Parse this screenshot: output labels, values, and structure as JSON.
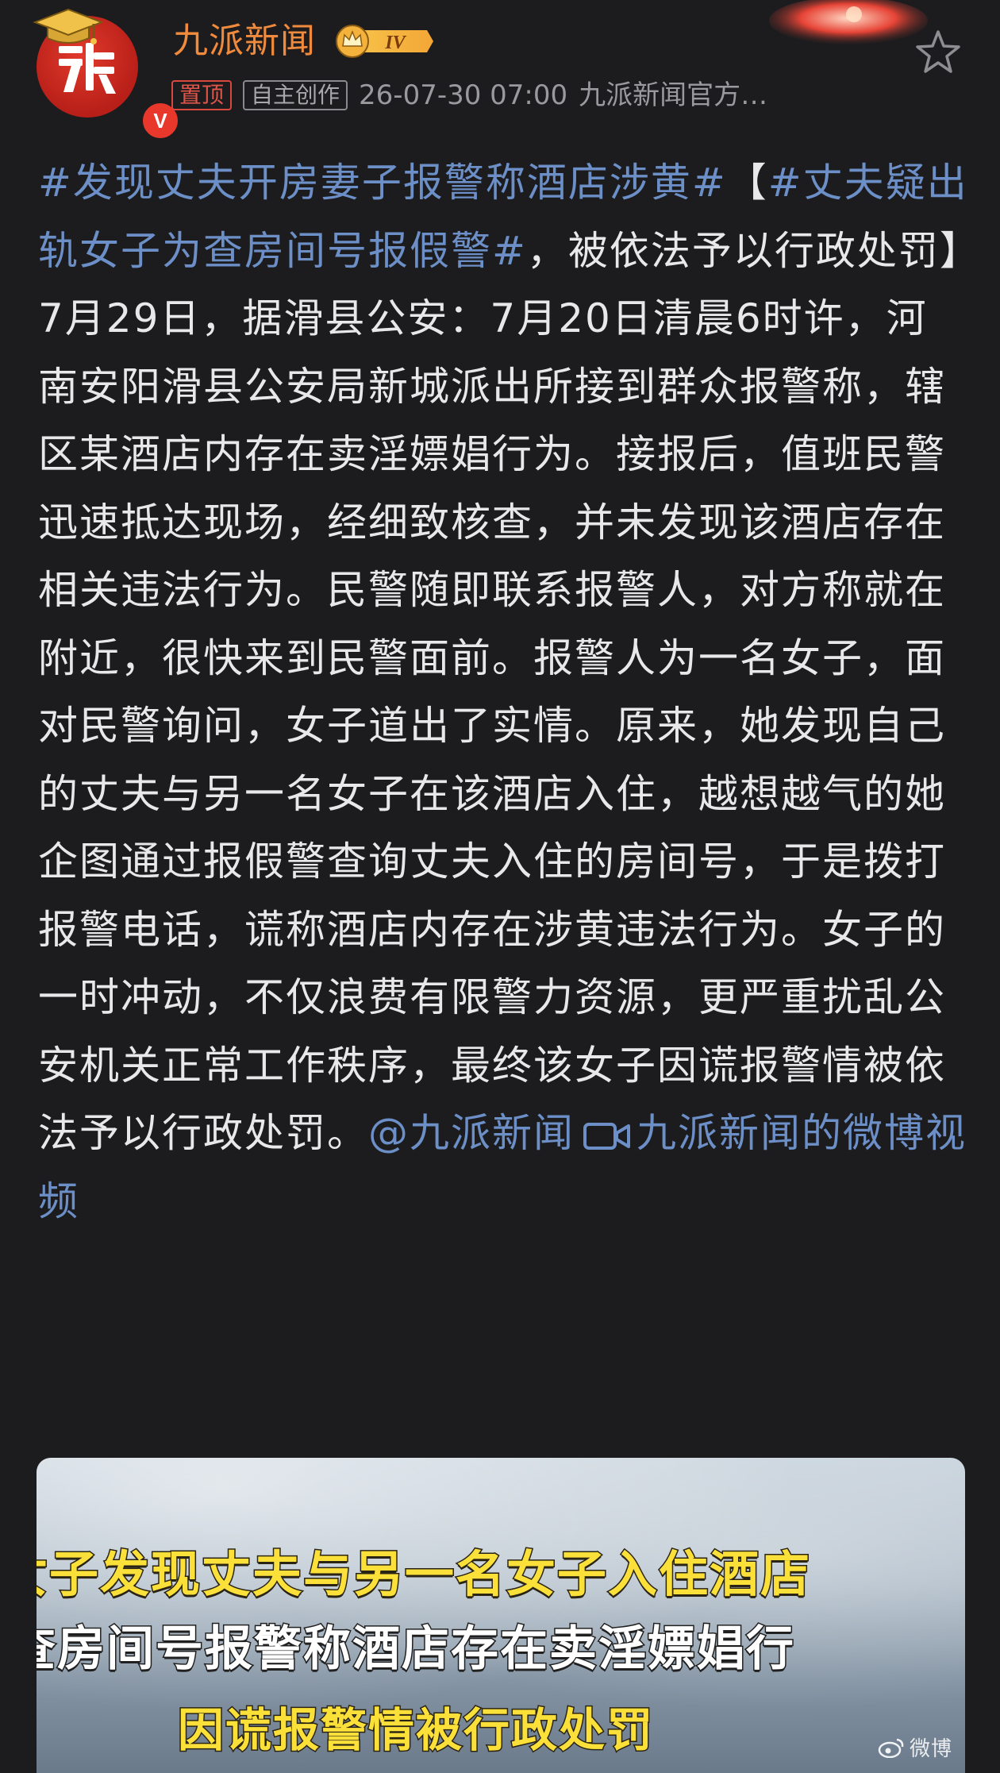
{
  "author": {
    "name": "九派新闻",
    "level_badge": "IV",
    "verified_mark": "V",
    "avatar_icon": "jiupai-logo-icon"
  },
  "meta": {
    "pinned_label": "置顶",
    "original_label": "自主创作",
    "timestamp": "26-07-30 07:00",
    "source": "九派新闻官方…"
  },
  "post": {
    "hashtag1": "#发现丈夫开房妻子报警称酒店涉黄#",
    "bracket_open": "【",
    "hashtag2": "#丈夫疑出轨女子为查房间号报假警#",
    "after_hashtag2": "，被依法予以行政处罚】7月29日，据滑县公安：7月20日清晨6时许，河南安阳滑县公安局新城派出所接到群众报警称，辖区某酒店内存在卖淫嫖娼行为。接报后，值班民警迅速抵达现场，经细致核查，并未发现该酒店存在相关违法行为。民警随即联系报警人，对方称就在附近，很快来到民警面前。报警人为一名女子，面对民警询问，女子道出了实情。原来，她发现自己的丈夫与另一名女子在该酒店入住，越想越气的她企图通过报假警查询丈夫入住的房间号，于是拨打报警电话，谎称酒店内存在涉黄违法行为。女子的一时冲动，不仅浪费有限警力资源，更严重扰乱公安机关正常工作秩序，最终该女子因谎报警情被依法予以行政处罚。",
    "mention": "@九派新闻",
    "video_link": "九派新闻的微博视频"
  },
  "media": {
    "caption_line1": "女子发现丈夫与另一名女子入住酒店",
    "caption_line2": "查房间号报警称酒店存在卖淫嫖娼行",
    "caption_line3": "因谎报警情被行政处罚",
    "watermark": "微博"
  },
  "colors": {
    "background": "#1c1c1e",
    "link": "#6c8fc7",
    "username": "#f08a3c",
    "pinned": "#e0554a"
  }
}
